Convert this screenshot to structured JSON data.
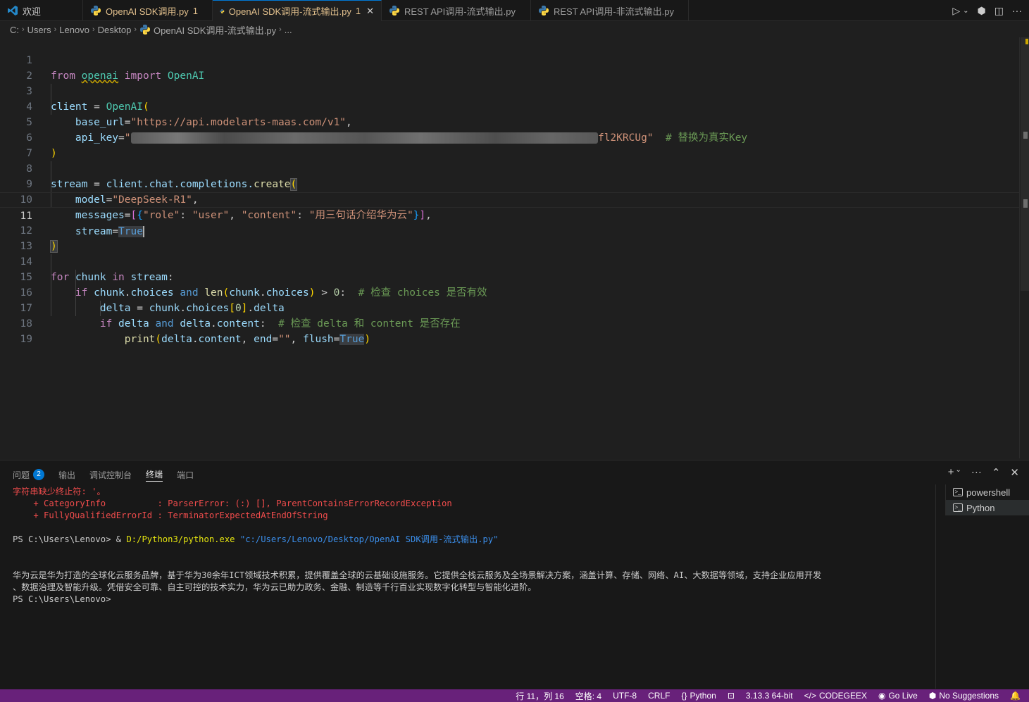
{
  "tabs": [
    {
      "label": "欢迎",
      "modified": false,
      "active": false,
      "icon": "vscode-logo-icon"
    },
    {
      "label": "OpenAI SDK调用.py",
      "badge": "1",
      "modified": true,
      "active": false,
      "icon": "python-icon"
    },
    {
      "label": "OpenAI SDK调用-流式输出.py",
      "badge": "1",
      "modified": true,
      "active": true,
      "icon": "python-icon"
    },
    {
      "label": "REST API调用-流式输出.py",
      "modified": false,
      "active": false,
      "icon": "python-icon"
    },
    {
      "label": "REST API调用-非流式输出.py",
      "modified": false,
      "active": false,
      "icon": "python-icon"
    }
  ],
  "breadcrumb": [
    "C:",
    "Users",
    "Lenovo",
    "Desktop",
    "OpenAI SDK调用-流式输出.py",
    "..."
  ],
  "editor": {
    "current_line": 11,
    "line_numbers": [
      "1",
      "2",
      "3",
      "4",
      "5",
      "6",
      "7",
      "8",
      "9",
      "10",
      "11",
      "12",
      "13",
      "14",
      "15",
      "16",
      "17",
      "18",
      "19"
    ],
    "code": {
      "l1_from": "from",
      "l1_mod": "openai",
      "l1_import": "import",
      "l1_cls": "OpenAI",
      "l3_var": "client",
      "l3_eq": " = ",
      "l3_cls": "OpenAI",
      "l4_param": "base_url",
      "l4_str": "\"https://api.modelarts-maas.com/v1\"",
      "l5_param": "api_key",
      "l5_str_open": "\"",
      "l5_blur": "xxxxxxxxxxxxxxxxxxxxxxxxxxxxxxxxxxxxxxxxxxxxxxxxxxxxxxxxxxxxxxxxxxxxxxxxxxxx",
      "l5_str_end": "fl2KRCUg\"",
      "l5_comment": "# 替换为真实Key",
      "l8_var": "stream",
      "l8_obj": "client",
      "l8_chain": ".chat.completions.",
      "l8_fn": "create",
      "l9_param": "model",
      "l9_str": "\"DeepSeek-R1\"",
      "l10_param": "messages",
      "l10_k1": "\"role\"",
      "l10_v1": "\"user\"",
      "l10_k2": "\"content\"",
      "l10_v2": "\"用三句话介绍华为云\"",
      "l11_param": "stream",
      "l11_val": "True",
      "l14_for": "for",
      "l14_var": "chunk",
      "l14_in": "in",
      "l14_iter": "stream",
      "l15_if": "if",
      "l15_obj": "chunk",
      "l15_attr": "choices",
      "l15_and": "and",
      "l15_fn": "len",
      "l15_num": "0",
      "l15_comment": "# 检查 choices 是否有效",
      "l16_var": "delta",
      "l16_obj": "chunk",
      "l16_attr": "choices",
      "l16_idx": "0",
      "l16_attr2": "delta",
      "l17_if": "if",
      "l17_var": "delta",
      "l17_and": "and",
      "l17_attr": "content",
      "l17_comment": "# 检查 delta 和 content 是否存在",
      "l18_fn": "print",
      "l18_var": "delta",
      "l18_attr": "content",
      "l18_p1": "end",
      "l18_str": "\"\"",
      "l18_p2": "flush",
      "l18_val": "True"
    }
  },
  "panel": {
    "tabs": [
      {
        "label": "问题",
        "badge": "2",
        "active": false
      },
      {
        "label": "输出",
        "active": false
      },
      {
        "label": "调试控制台",
        "active": false
      },
      {
        "label": "终端",
        "active": true
      },
      {
        "label": "端口",
        "active": false
      }
    ],
    "terminal": {
      "err1": "字符串缺少终止符: '。",
      "err2": "    + CategoryInfo          : ParserError: (:) [], ParentContainsErrorRecordException",
      "err3": "    + FullyQualifiedErrorId : TerminatorExpectedAtEndOfString",
      "prompt1": "PS C:\\Users\\Lenovo> & ",
      "exe": "D:/Python3/python.exe",
      "script_path": " \"c:/Users/Lenovo/Desktop/OpenAI SDK调用-流式输出.py\"",
      "output1": "华为云是华为打造的全球化云服务品牌，基于华为30余年ICT领域技术积累，提供覆盖全球的云基础设施服务。它提供全栈云服务及全场景解决方案，涵盖计算、存储、网络、AI、大数据等领域，支持企业应用开发",
      "output2": "、数据治理及智能升级。凭借安全可靠、自主可控的技术实力，华为云已助力政务、金融、制造等千行百业实现数字化转型与智能化进阶。",
      "prompt2": "PS C:\\Users\\Lenovo>"
    },
    "terminals": [
      {
        "label": "powershell",
        "selected": false
      },
      {
        "label": "Python",
        "selected": true
      }
    ]
  },
  "statusbar": {
    "position": "行 11，列 16",
    "spaces": "空格: 4",
    "encoding": "UTF-8",
    "eol": "CRLF",
    "language": "Python",
    "interpreter": "3.13.3 64-bit",
    "codegeex": "CODEGEEX",
    "golive": "Go Live",
    "suggestions": "No Suggestions"
  },
  "colors": {
    "statusbar": "#68217a",
    "accent": "#0078d4",
    "modified_tab": "#e2c08d"
  }
}
